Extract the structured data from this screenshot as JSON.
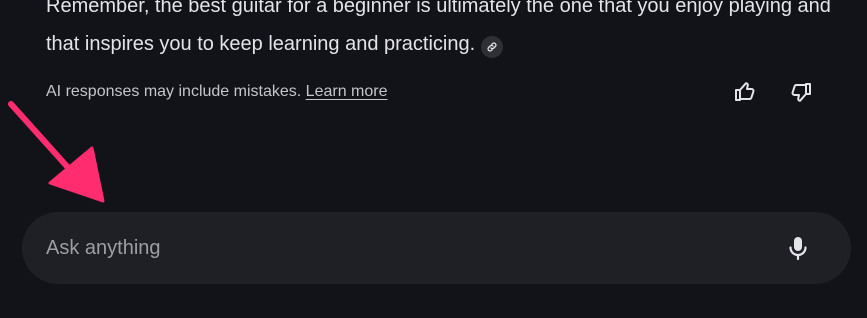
{
  "answer": {
    "line1": "Remember, the best guitar for a beginner is ultimately the one that you enjoy playing and",
    "line2": "that inspires you to keep learning and practicing."
  },
  "disclaimer": {
    "text": "AI responses may include mistakes. ",
    "link_label": "Learn more"
  },
  "feedback": {
    "thumbs_up_icon": "thumbs-up-icon",
    "thumbs_down_icon": "thumbs-down-icon"
  },
  "search": {
    "placeholder": "Ask anything",
    "value": "",
    "mic_icon": "microphone-icon"
  },
  "annotation": {
    "arrow_color": "#ff2d6f"
  },
  "colors": {
    "background": "#121318",
    "search_bar": "#1f2025",
    "text": "#e3e3e8",
    "muted_text": "#c4c5ca"
  }
}
